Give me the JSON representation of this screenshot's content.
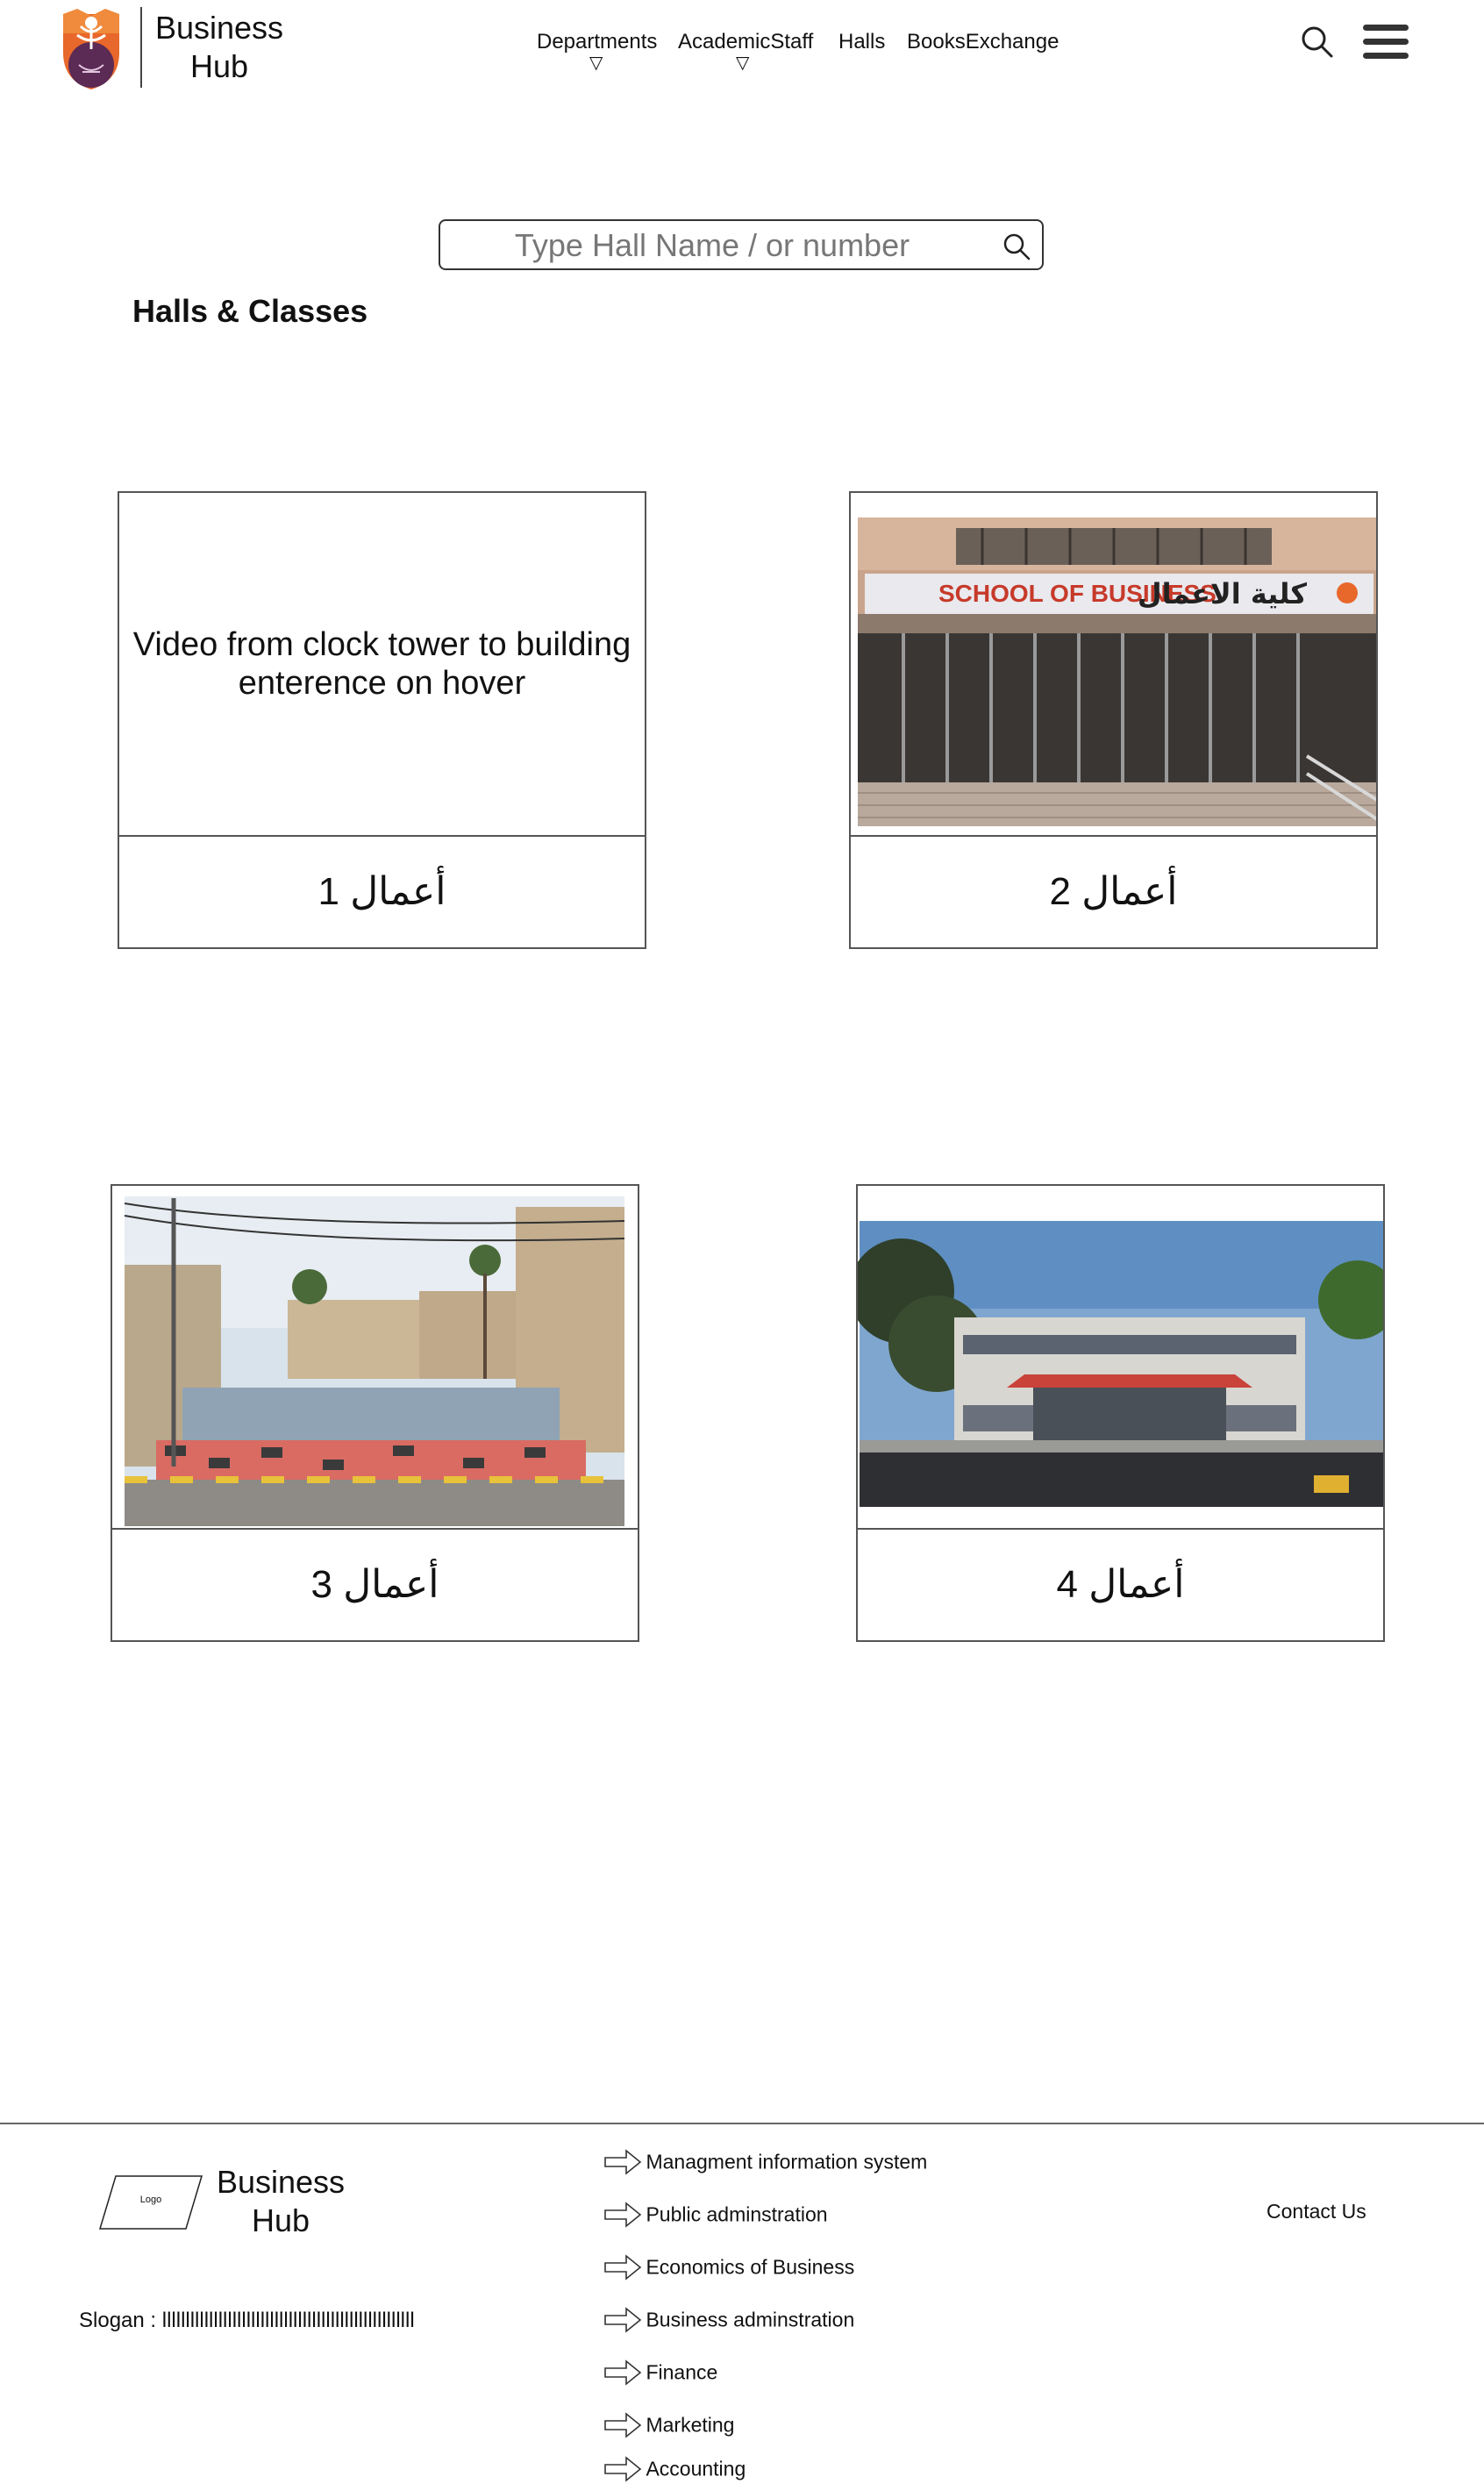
{
  "header": {
    "brand_line1": "Business",
    "brand_line2": "Hub",
    "nav": [
      {
        "label": "Departments",
        "has_dropdown": true
      },
      {
        "label": "AcademicStaff",
        "has_dropdown": true
      },
      {
        "label": "Halls",
        "has_dropdown": false
      },
      {
        "label": "BooksExchange",
        "has_dropdown": false
      }
    ],
    "caret": "▽",
    "search_icon": "search-icon",
    "menu_icon": "hamburger-menu-icon"
  },
  "search": {
    "placeholder": "Type Hall Name / or number"
  },
  "section_title": "Halls & Classes",
  "halls": [
    {
      "label": "أعمال 1",
      "media": "video-placeholder",
      "media_text": "Video from clock tower to building enterence on hover"
    },
    {
      "label": "أعمال 2",
      "media": "building-entrance-photo",
      "sign_en": "SCHOOL OF BUSINESS",
      "sign_ar": "كلية الاعمال"
    },
    {
      "label": "أعمال 3",
      "media": "campus-stairs-photo"
    },
    {
      "label": "أعمال 4",
      "media": "building-facade-photo"
    }
  ],
  "footer": {
    "logo_text": "Logo",
    "brand_line1": "Business",
    "brand_line2": "Hub",
    "slogan": "Slogan  : llllllllllllllllllllllllllllllllllllllllllllllllllllll",
    "links": [
      "Managment information system",
      "Public adminstration",
      "Economics of Business",
      "Business adminstration",
      "Finance",
      "Marketing",
      "Accounting"
    ],
    "contact": "Contact Us"
  },
  "colors": {
    "crest_orange": "#e8672b",
    "crest_purple": "#5b2a55",
    "border": "#555555"
  }
}
